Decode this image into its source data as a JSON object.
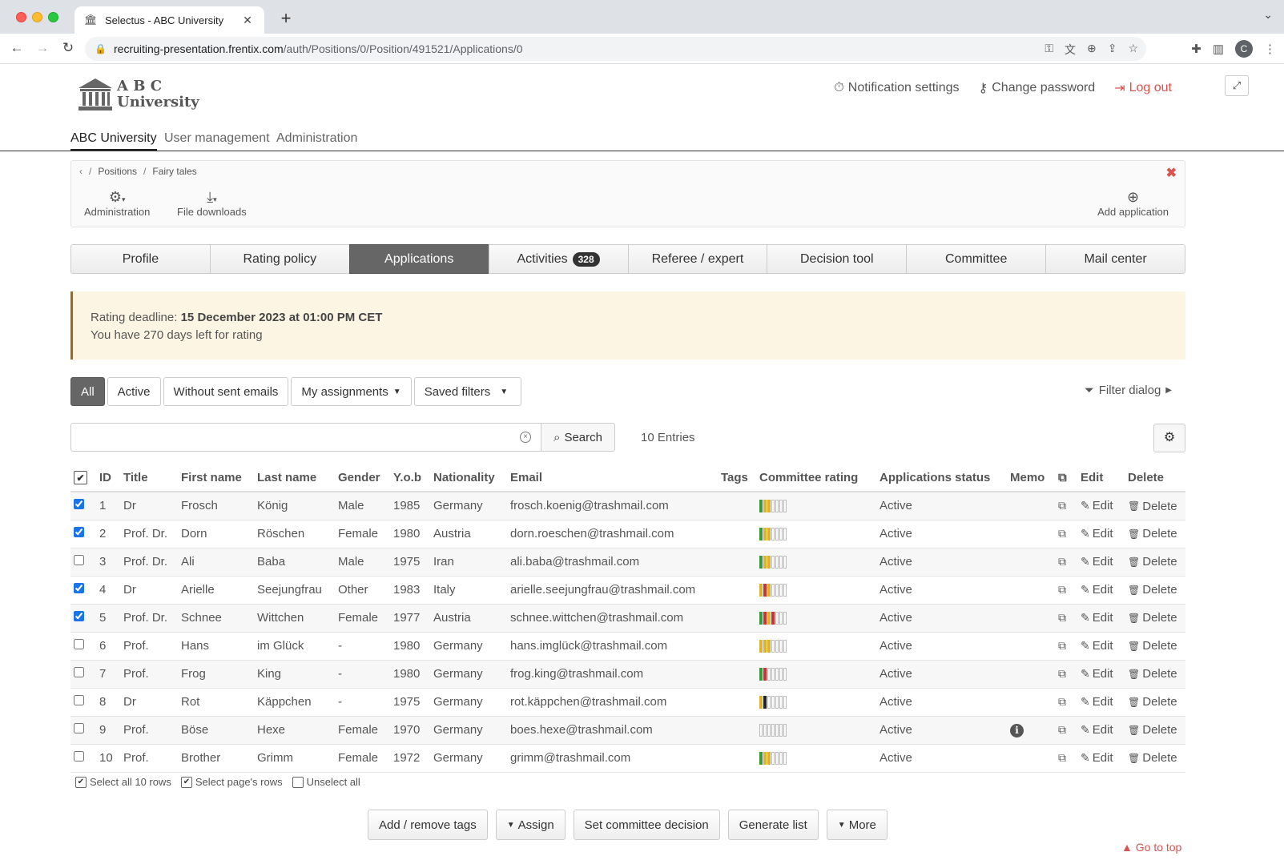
{
  "browser": {
    "tab_title": "Selectus - ABC University",
    "url_host": "recruiting-presentation.frentix.com",
    "url_path": "/auth/Positions/0/Position/491521/Applications/0",
    "profile_initial": "C"
  },
  "header": {
    "logo_line1": "A B C",
    "logo_line2": "University",
    "notification_settings": "Notification settings",
    "change_password": "Change password",
    "logout": "Log out"
  },
  "mainnav": {
    "items": [
      "ABC University",
      "User management",
      "Administration"
    ],
    "active": "ABC University"
  },
  "panel": {
    "breadcrumb": [
      "Positions",
      "Fairy tales"
    ],
    "administration": "Administration",
    "file_downloads": "File downloads",
    "add_application": "Add application"
  },
  "tabs": [
    {
      "label": "Profile"
    },
    {
      "label": "Rating policy"
    },
    {
      "label": "Applications",
      "active": true
    },
    {
      "label": "Activities",
      "badge": "328"
    },
    {
      "label": "Referee / expert"
    },
    {
      "label": "Decision tool"
    },
    {
      "label": "Committee"
    },
    {
      "label": "Mail center"
    }
  ],
  "alert": {
    "deadline_label": "Rating deadline:",
    "deadline_value": "15 December 2023 at 01:00 PM CET",
    "days_left": "You have 270 days left for rating"
  },
  "filters": {
    "all": "All",
    "active": "Active",
    "without_sent_emails": "Without sent emails",
    "my_assignments": "My assignments",
    "saved_filters": "Saved filters",
    "filter_dialog": "Filter dialog"
  },
  "search": {
    "value": "",
    "button": "Search",
    "entries": "10 Entries"
  },
  "table": {
    "headers": {
      "id": "ID",
      "title": "Title",
      "first_name": "First name",
      "last_name": "Last name",
      "gender": "Gender",
      "yob": "Y.o.b",
      "nationality": "Nationality",
      "email": "Email",
      "tags": "Tags",
      "committee_rating": "Committee rating",
      "status": "Applications status",
      "memo": "Memo",
      "edit": "Edit",
      "delete": "Delete"
    },
    "edit_label": "Edit",
    "delete_label": "Delete",
    "rows": [
      {
        "checked": true,
        "id": "1",
        "title": "Dr",
        "first": "Frosch",
        "last": "König",
        "gender": "Male",
        "yob": "1985",
        "nat": "Germany",
        "email": "frosch.koenig@trashmail.com",
        "rating": [
          "#3a9a3a",
          "#e0b030",
          "#e0b030",
          "",
          "",
          "",
          ""
        ],
        "status": "Active",
        "memo": false
      },
      {
        "checked": true,
        "id": "2",
        "title": "Prof. Dr.",
        "first": "Dorn",
        "last": "Röschen",
        "gender": "Female",
        "yob": "1980",
        "nat": "Austria",
        "email": "dorn.roeschen@trashmail.com",
        "rating": [
          "#3a9a3a",
          "#e0b030",
          "#e0b030",
          "",
          "",
          "",
          ""
        ],
        "status": "Active",
        "memo": false
      },
      {
        "checked": false,
        "id": "3",
        "title": "Prof. Dr.",
        "first": "Ali",
        "last": "Baba",
        "gender": "Male",
        "yob": "1975",
        "nat": "Iran",
        "email": "ali.baba@trashmail.com",
        "rating": [
          "#3a9a3a",
          "#e0b030",
          "#e0b030",
          "",
          "",
          "",
          ""
        ],
        "status": "Active",
        "memo": false
      },
      {
        "checked": true,
        "id": "4",
        "title": "Dr",
        "first": "Arielle",
        "last": "Seejungfrau",
        "gender": "Other",
        "yob": "1983",
        "nat": "Italy",
        "email": "arielle.seejungfrau@trashmail.com",
        "rating": [
          "#e0b030",
          "#d03030",
          "#e0b030",
          "",
          "",
          "",
          ""
        ],
        "status": "Active",
        "memo": false
      },
      {
        "checked": true,
        "id": "5",
        "title": "Prof. Dr.",
        "first": "Schnee",
        "last": "Wittchen",
        "gender": "Female",
        "yob": "1977",
        "nat": "Austria",
        "email": "schnee.wittchen@trashmail.com",
        "rating": [
          "#3a9a3a",
          "#d03030",
          "#e0b030",
          "#d03030",
          "",
          "",
          ""
        ],
        "status": "Active",
        "memo": false
      },
      {
        "checked": false,
        "id": "6",
        "title": "Prof.",
        "first": "Hans",
        "last": "im Glück",
        "gender": "-",
        "yob": "1980",
        "nat": "Germany",
        "email": "hans.imglück@trashmail.com",
        "rating": [
          "#e0b030",
          "#e0b030",
          "#e0b030",
          "",
          "",
          "",
          ""
        ],
        "status": "Active",
        "memo": false
      },
      {
        "checked": false,
        "id": "7",
        "title": "Prof.",
        "first": "Frog",
        "last": "King",
        "gender": "-",
        "yob": "1980",
        "nat": "Germany",
        "email": "frog.king@trashmail.com",
        "rating": [
          "#3a9a3a",
          "#d03030",
          "",
          "",
          "",
          "",
          ""
        ],
        "status": "Active",
        "memo": false
      },
      {
        "checked": false,
        "id": "8",
        "title": "Dr",
        "first": "Rot",
        "last": "Käppchen",
        "gender": "-",
        "yob": "1975",
        "nat": "Germany",
        "email": "rot.käppchen@trashmail.com",
        "rating": [
          "#e0b030",
          "#222222",
          "",
          "",
          "",
          "",
          ""
        ],
        "status": "Active",
        "memo": false
      },
      {
        "checked": false,
        "id": "9",
        "title": "Prof.",
        "first": "Böse",
        "last": "Hexe",
        "gender": "Female",
        "yob": "1970",
        "nat": "Germany",
        "email": "boes.hexe@trashmail.com",
        "rating": [
          "",
          "",
          "",
          "",
          "",
          "",
          ""
        ],
        "status": "Active",
        "memo": true
      },
      {
        "checked": false,
        "id": "10",
        "title": "Prof.",
        "first": "Brother",
        "last": "Grimm",
        "gender": "Female",
        "yob": "1972",
        "nat": "Germany",
        "email": "grimm@trashmail.com",
        "rating": [
          "#3a9a3a",
          "#e0b030",
          "#e0b030",
          "",
          "",
          "",
          ""
        ],
        "status": "Active",
        "memo": false
      }
    ]
  },
  "select_rows": {
    "select_all": "Select all 10 rows",
    "select_page": "Select page's rows",
    "unselect_all": "Unselect all"
  },
  "bottom_actions": {
    "add_remove_tags": "Add / remove tags",
    "assign": "Assign",
    "set_committee_decision": "Set committee decision",
    "generate_list": "Generate list",
    "more": "More",
    "go_to_top": "Go to top"
  }
}
